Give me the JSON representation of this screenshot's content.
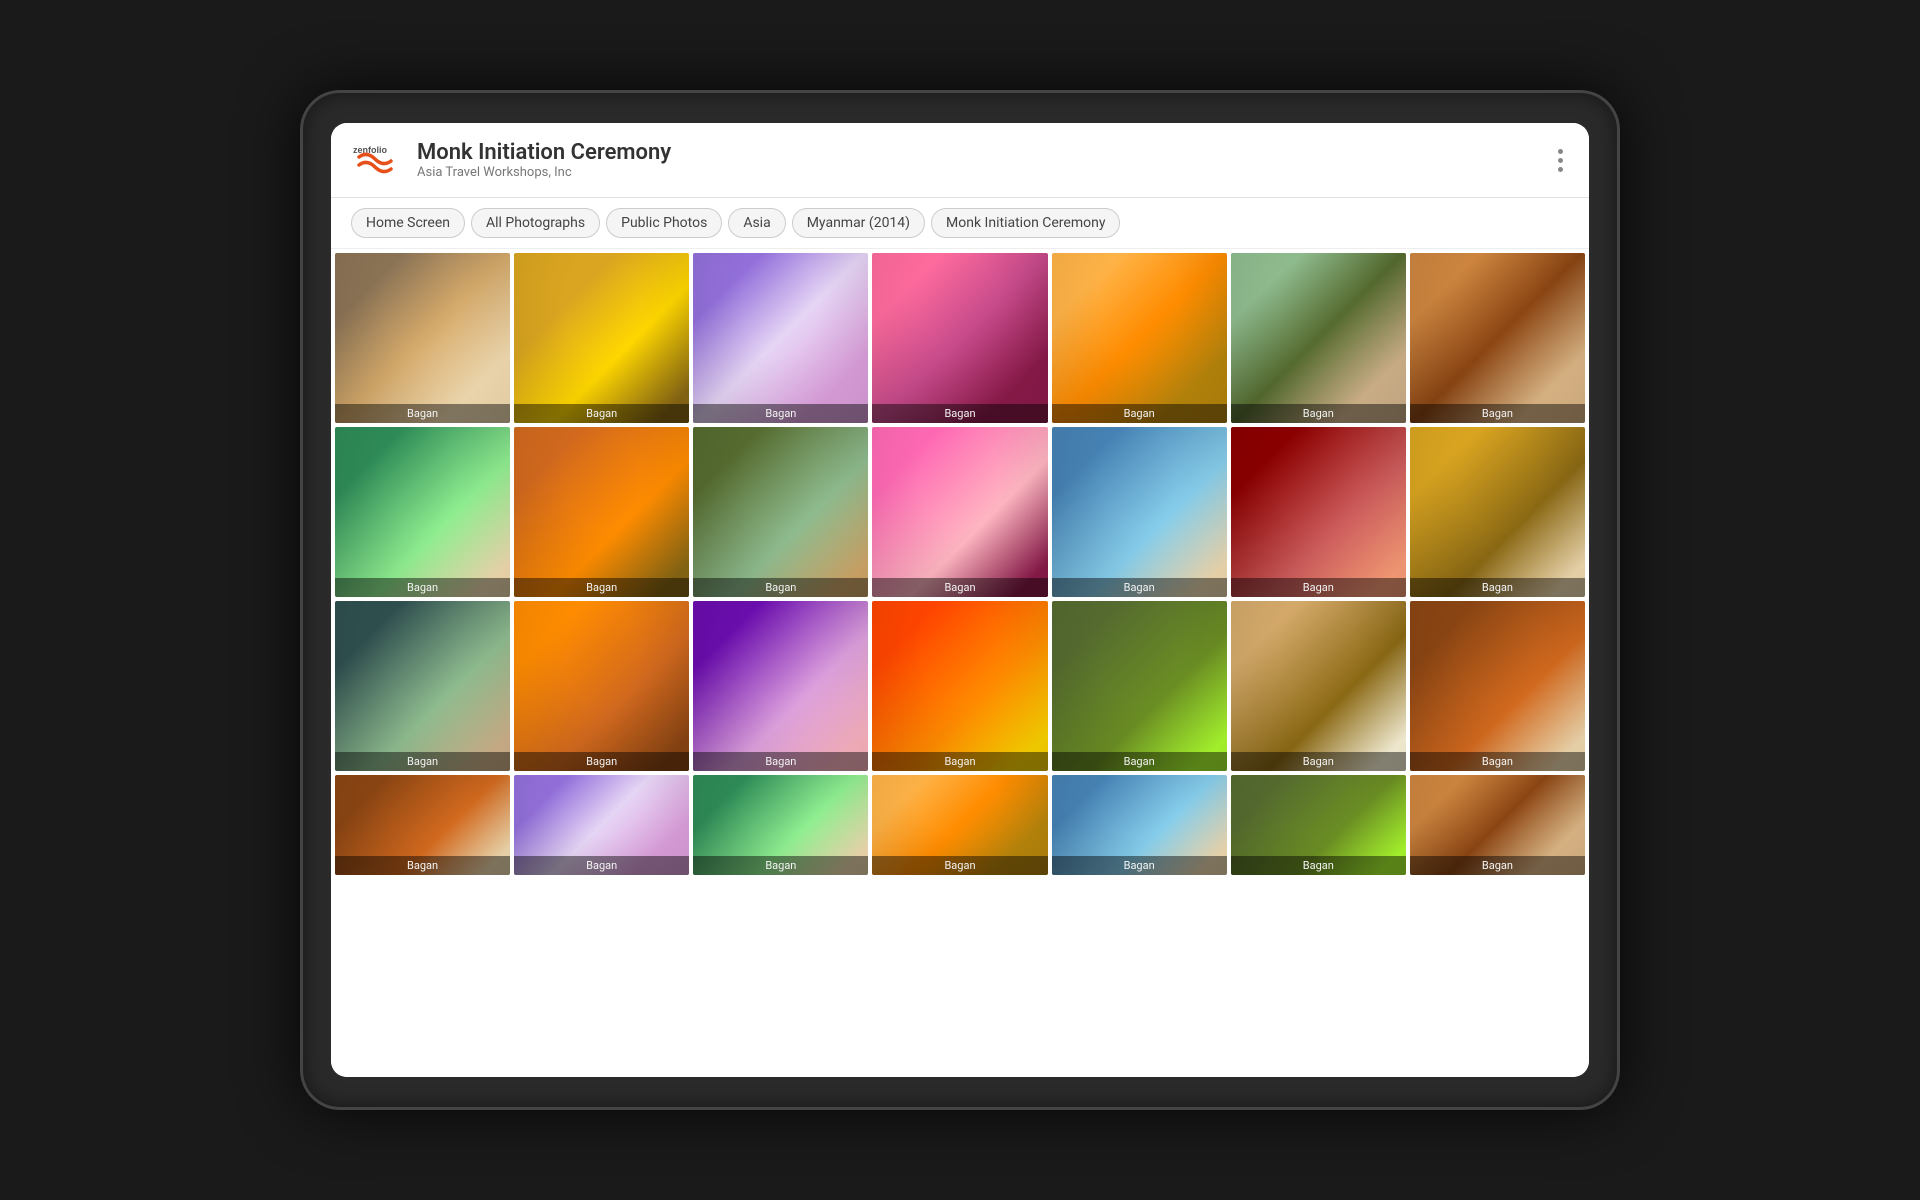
{
  "header": {
    "logo_text": "zenfolio",
    "title": "Monk Initiation Ceremony",
    "subtitle": "Asia Travel Workshops, Inc"
  },
  "breadcrumbs": [
    {
      "label": "Home Screen",
      "id": "home-screen"
    },
    {
      "label": "All Photographs",
      "id": "all-photographs"
    },
    {
      "label": "Public Photos",
      "id": "public-photos"
    },
    {
      "label": "Asia",
      "id": "asia"
    },
    {
      "label": "Myanmar (2014)",
      "id": "myanmar-2014"
    },
    {
      "label": "Monk Initiation Ceremony",
      "id": "monk-initiation"
    }
  ],
  "photos": {
    "row1": [
      {
        "label": "Bagan",
        "color_class": "p1"
      },
      {
        "label": "Bagan",
        "color_class": "p2"
      },
      {
        "label": "Bagan",
        "color_class": "p3"
      },
      {
        "label": "Bagan",
        "color_class": "p4"
      },
      {
        "label": "Bagan",
        "color_class": "p5"
      },
      {
        "label": "Bagan",
        "color_class": "p6"
      },
      {
        "label": "Bagan",
        "color_class": "p7"
      }
    ],
    "row2": [
      {
        "label": "Bagan",
        "color_class": "p8"
      },
      {
        "label": "Bagan",
        "color_class": "p9"
      },
      {
        "label": "Bagan",
        "color_class": "p10"
      },
      {
        "label": "Bagan",
        "color_class": "p11"
      },
      {
        "label": "Bagan",
        "color_class": "p12"
      },
      {
        "label": "Bagan",
        "color_class": "p13"
      },
      {
        "label": "Bagan",
        "color_class": "p14"
      }
    ],
    "row3": [
      {
        "label": "Bagan",
        "color_class": "p15"
      },
      {
        "label": "Bagan",
        "color_class": "p16"
      },
      {
        "label": "Bagan",
        "color_class": "p17"
      },
      {
        "label": "Bagan",
        "color_class": "p18"
      },
      {
        "label": "Bagan",
        "color_class": "p19"
      },
      {
        "label": "Bagan",
        "color_class": "p20"
      },
      {
        "label": "Bagan",
        "color_class": "p21"
      }
    ],
    "row4": [
      {
        "label": "Bagan",
        "color_class": "p21"
      },
      {
        "label": "Bagan",
        "color_class": "p1"
      },
      {
        "label": "Bagan",
        "color_class": "p19"
      },
      {
        "label": "Bagan",
        "color_class": "p8"
      },
      {
        "label": "Bagan",
        "color_class": "p5"
      },
      {
        "label": "Bagan",
        "color_class": "p3"
      },
      {
        "label": "Bagan",
        "color_class": "p7"
      }
    ]
  }
}
